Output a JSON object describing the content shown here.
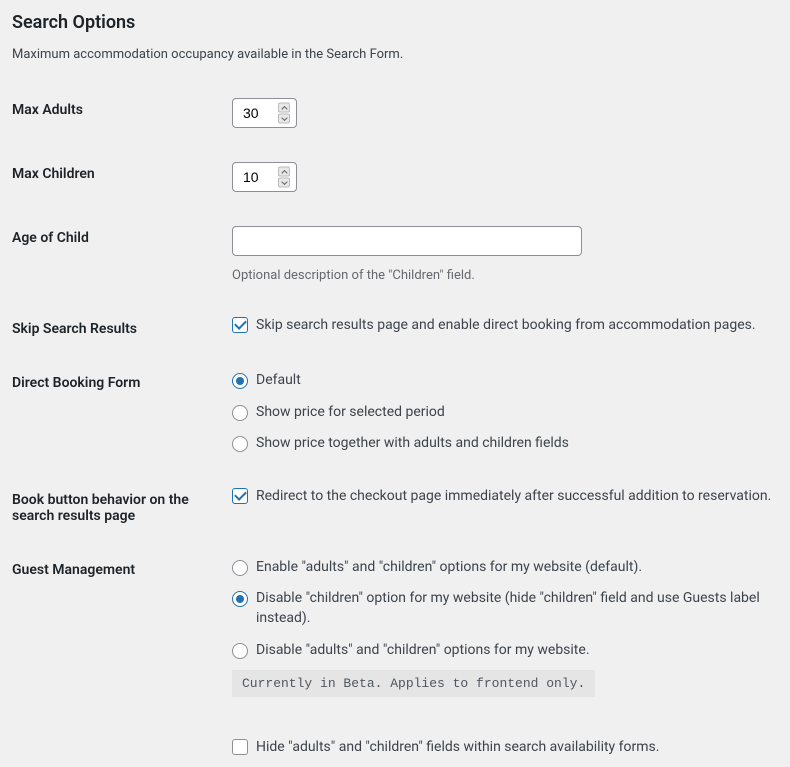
{
  "heading": "Search Options",
  "description": "Maximum accommodation occupancy available in the Search Form.",
  "maxAdults": {
    "label": "Max Adults",
    "value": "30"
  },
  "maxChildren": {
    "label": "Max Children",
    "value": "10"
  },
  "ageOfChild": {
    "label": "Age of Child",
    "value": "",
    "help": "Optional description of the \"Children\" field."
  },
  "skipSearch": {
    "label": "Skip Search Results",
    "checkboxLabel": "Skip search results page and enable direct booking from accommodation pages."
  },
  "directBooking": {
    "label": "Direct Booking Form",
    "options": [
      "Default",
      "Show price for selected period",
      "Show price together with adults and children fields"
    ]
  },
  "bookButton": {
    "label": "Book button behavior on the search results page",
    "checkboxLabel": "Redirect to the checkout page immediately after successful addition to reservation."
  },
  "guestManagement": {
    "label": "Guest Management",
    "options": [
      "Enable \"adults\" and \"children\" options for my website (default).",
      "Disable \"children\" option for my website (hide \"children\" field and use Guests label instead).",
      "Disable \"adults\" and \"children\" options for my website."
    ],
    "betaNote": "Currently in Beta. Applies to frontend only.",
    "hideLabel": "Hide \"adults\" and \"children\" fields within search availability forms."
  }
}
